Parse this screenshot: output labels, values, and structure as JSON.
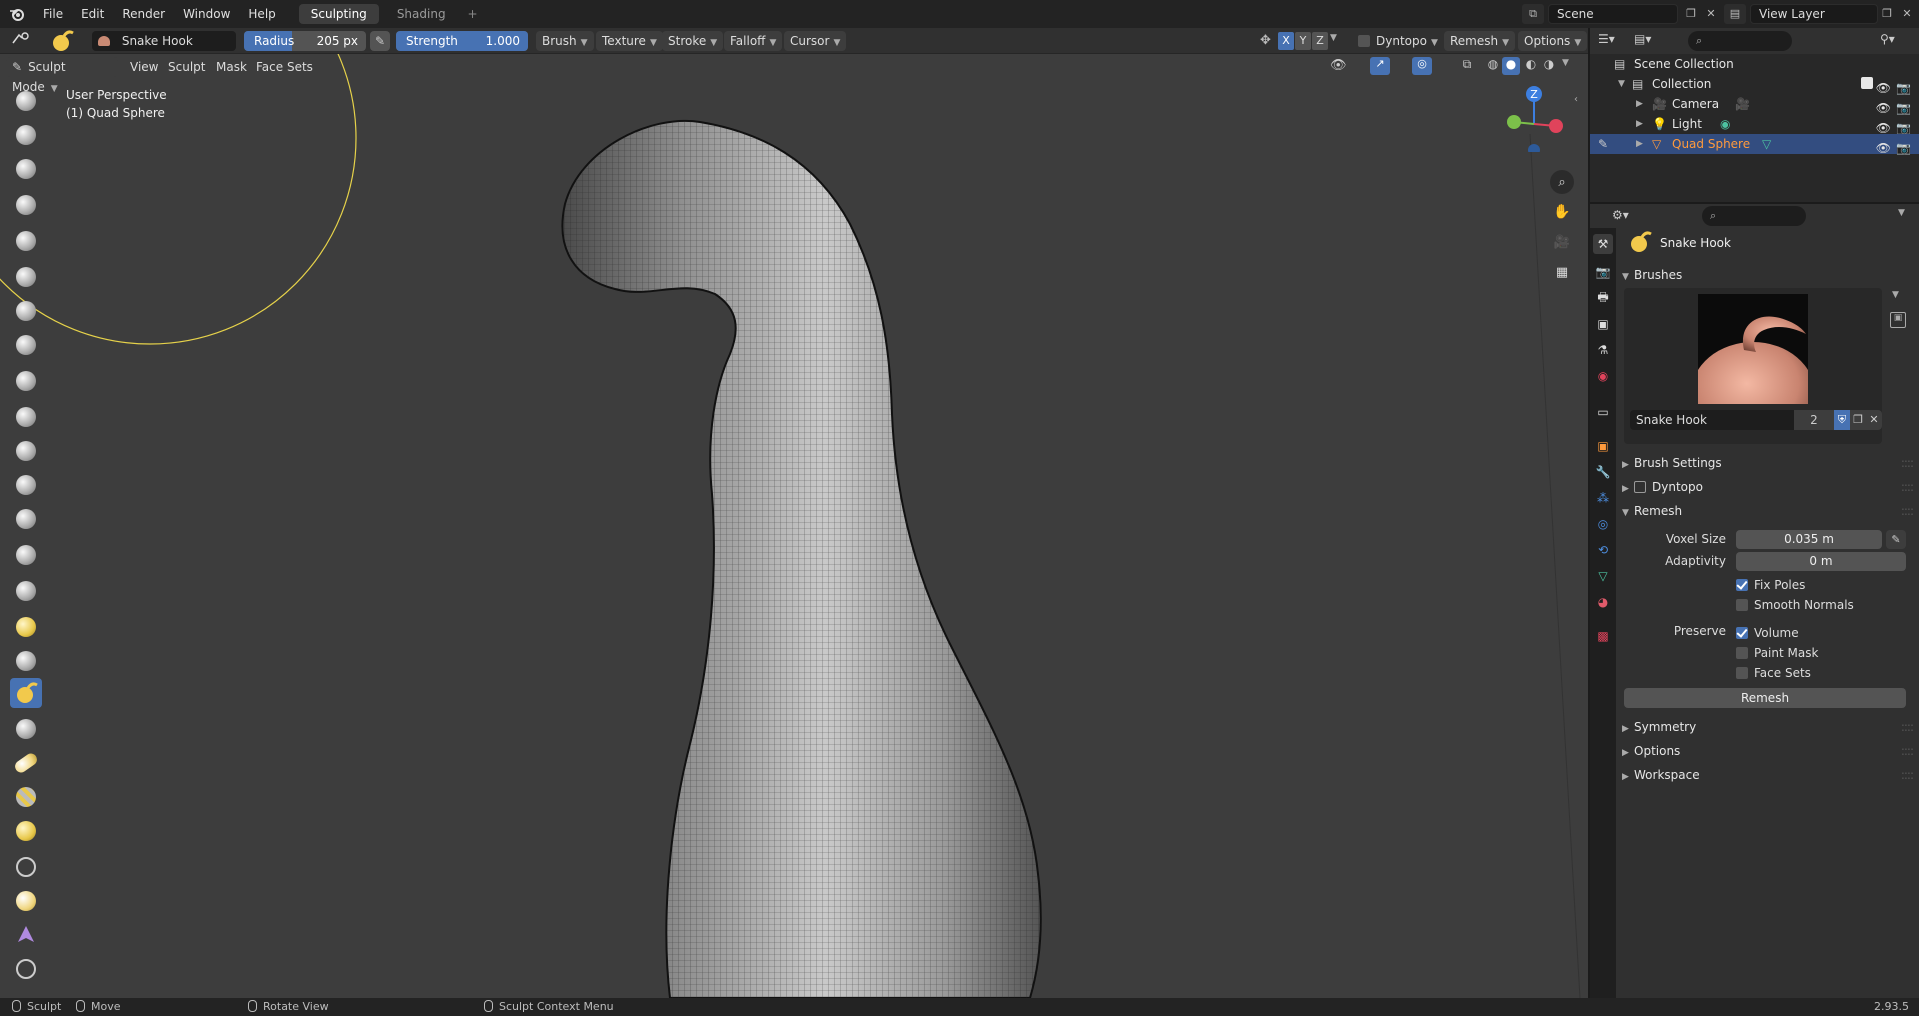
{
  "topbar": {
    "menus": [
      "File",
      "Edit",
      "Render",
      "Window",
      "Help"
    ],
    "workspace_tabs": [
      "Sculpting",
      "Shading"
    ],
    "active_tab": "Sculpting",
    "scene": "Scene",
    "view_layer": "View Layer"
  },
  "tool_header": {
    "brush_name": "Snake Hook",
    "radius_label": "Radius",
    "radius_value": "205 px",
    "strength_label": "Strength",
    "strength_value": "1.000",
    "strength_fraction": 1.0,
    "menus": [
      "Brush",
      "Texture",
      "Stroke",
      "Falloff",
      "Cursor"
    ],
    "axes": [
      "X",
      "Y",
      "Z"
    ],
    "dyntopo": "Dyntopo",
    "remesh": "Remesh",
    "options": "Options"
  },
  "viewport": {
    "mode": "Sculpt Mode",
    "menus": [
      "View",
      "Sculpt",
      "Mask",
      "Face Sets"
    ],
    "info_line1": "User Perspective",
    "info_line2": "(1) Quad Sphere",
    "gizmo": {
      "z": "Z"
    }
  },
  "outliner": {
    "root": "Scene Collection",
    "collection": "Collection",
    "items": [
      {
        "name": "Camera",
        "color": "#e59a3a"
      },
      {
        "name": "Light",
        "color": "#e59a3a"
      },
      {
        "name": "Quad Sphere",
        "color": "#ff9a3c",
        "selected": true
      }
    ]
  },
  "properties": {
    "brush_name": "Snake Hook",
    "panels": {
      "brushes": "Brushes",
      "brush_datablock": "Snake Hook",
      "brush_users": "2",
      "brush_settings": "Brush Settings",
      "dyntopo": "Dyntopo",
      "remesh": "Remesh",
      "symmetry": "Symmetry",
      "options": "Options",
      "workspace": "Workspace"
    },
    "remesh": {
      "voxel_size_label": "Voxel Size",
      "voxel_size": "0.035 m",
      "adaptivity_label": "Adaptivity",
      "adaptivity": "0 m",
      "fix_poles": "Fix Poles",
      "fix_poles_on": true,
      "smooth_normals": "Smooth Normals",
      "smooth_normals_on": false,
      "preserve_label": "Preserve",
      "volume": "Volume",
      "volume_on": true,
      "paint_mask": "Paint Mask",
      "paint_mask_on": false,
      "face_sets": "Face Sets",
      "face_sets_on": false,
      "button": "Remesh"
    }
  },
  "statusbar": {
    "sculpt": "Sculpt",
    "move": "Move",
    "rotate": "Rotate View",
    "context": "Sculpt Context Menu",
    "version": "2.93.5"
  },
  "colors": {
    "accent": "#4772b3",
    "selection": "#334d80",
    "brush_circle": "#e6d24a",
    "object_orange": "#ff9a3c"
  }
}
